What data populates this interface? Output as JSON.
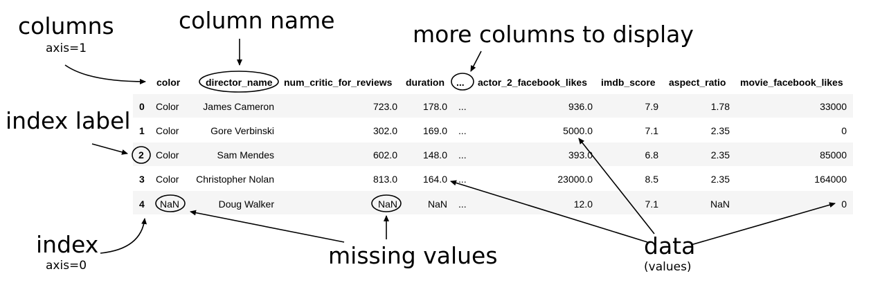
{
  "annotations": {
    "columns": "columns",
    "columns_axis": "axis=1",
    "column_name": "column name",
    "more_columns": "more columns to display",
    "index_label": "index label",
    "index": "index",
    "index_axis": "axis=0",
    "missing_values": "missing values",
    "data": "data",
    "data_sub": "(values)"
  },
  "table": {
    "columns": [
      "color",
      "director_name",
      "num_critic_for_reviews",
      "duration",
      "...",
      "actor_2_facebook_likes",
      "imdb_score",
      "aspect_ratio",
      "movie_facebook_likes"
    ],
    "rows": [
      {
        "index": "0",
        "cells": [
          "Color",
          "James Cameron",
          "723.0",
          "178.0",
          "...",
          "936.0",
          "7.9",
          "1.78",
          "33000"
        ]
      },
      {
        "index": "1",
        "cells": [
          "Color",
          "Gore Verbinski",
          "302.0",
          "169.0",
          "...",
          "5000.0",
          "7.1",
          "2.35",
          "0"
        ]
      },
      {
        "index": "2",
        "cells": [
          "Color",
          "Sam Mendes",
          "602.0",
          "148.0",
          "...",
          "393.0",
          "6.8",
          "2.35",
          "85000"
        ]
      },
      {
        "index": "3",
        "cells": [
          "Color",
          "Christopher Nolan",
          "813.0",
          "164.0",
          "...",
          "23000.0",
          "8.5",
          "2.35",
          "164000"
        ]
      },
      {
        "index": "4",
        "cells": [
          "NaN",
          "Doug Walker",
          "NaN",
          "NaN",
          "...",
          "12.0",
          "7.1",
          "NaN",
          "0"
        ]
      }
    ]
  }
}
